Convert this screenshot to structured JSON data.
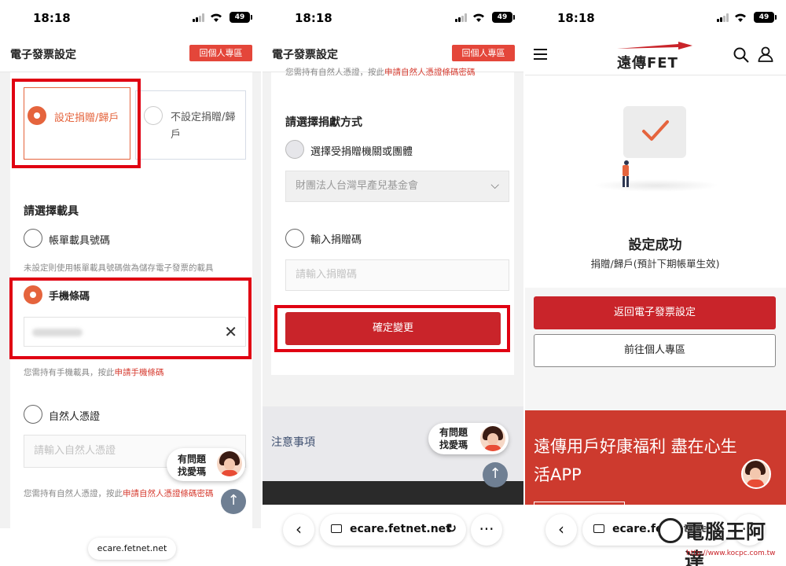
{
  "status_bar": {
    "time": "18:18",
    "battery": "49"
  },
  "panel1": {
    "header_title": "電子發票設定",
    "personal_button": "回個人專區",
    "option_donate": "設定捐贈/歸戶",
    "option_no_donate": "不設定捐贈/歸戶",
    "carrier_section": "請選擇載具",
    "carrier_bill": "帳單載具號碼",
    "carrier_bill_note": "未設定則使用帳單載具號碼做為儲存電子發票的載具",
    "carrier_mobile": "手機條碼",
    "mobile_note": "您需持有手機載具，按此",
    "mobile_link": "申請手機條碼",
    "carrier_citizen": "自然人憑證",
    "citizen_placeholder": "請輸入自然人憑證",
    "citizen_note": "您需持有自然人憑證，按此",
    "citizen_link": "申請自然人憑證條碼密碼",
    "chat_line1": "有問題",
    "chat_line2": "找愛瑪",
    "url": "ecare.fetnet.net"
  },
  "panel2": {
    "header_title": "電子發票設定",
    "personal_button": "回個人專區",
    "top_note": "您需持有自然人憑證，按此",
    "top_link": "申請自然人憑證條碼密碼",
    "donate_section": "請選擇捐獻方式",
    "option_org": "選擇受捐贈機關或團體",
    "org_selected": "財團法人台灣早產兒基金會",
    "option_code": "輸入捐贈碼",
    "code_placeholder": "請輸入捐贈碼",
    "confirm_button": "確定變更",
    "notice_title": "注意事項",
    "chat_line1": "有問題",
    "chat_line2": "找愛瑪",
    "url": "ecare.fetnet.net"
  },
  "panel3": {
    "logo_text": "遠傳FET",
    "success_title": "設定成功",
    "success_sub": "捐贈/歸戶(預計下期帳單生效)",
    "back_button": "返回電子發票設定",
    "personal_button": "前往個人專區",
    "banner_line1": "遠傳用戶好康福利 盡在心生",
    "banner_line2": "活APP",
    "url": "ecare.fetnet.net"
  },
  "watermark": {
    "text": "電腦王阿達",
    "url": "http://www.kocpc.com.tw"
  },
  "colors": {
    "brand_red": "#c9242a",
    "radio_orange": "#e5643d",
    "highlight": "#e00012"
  }
}
